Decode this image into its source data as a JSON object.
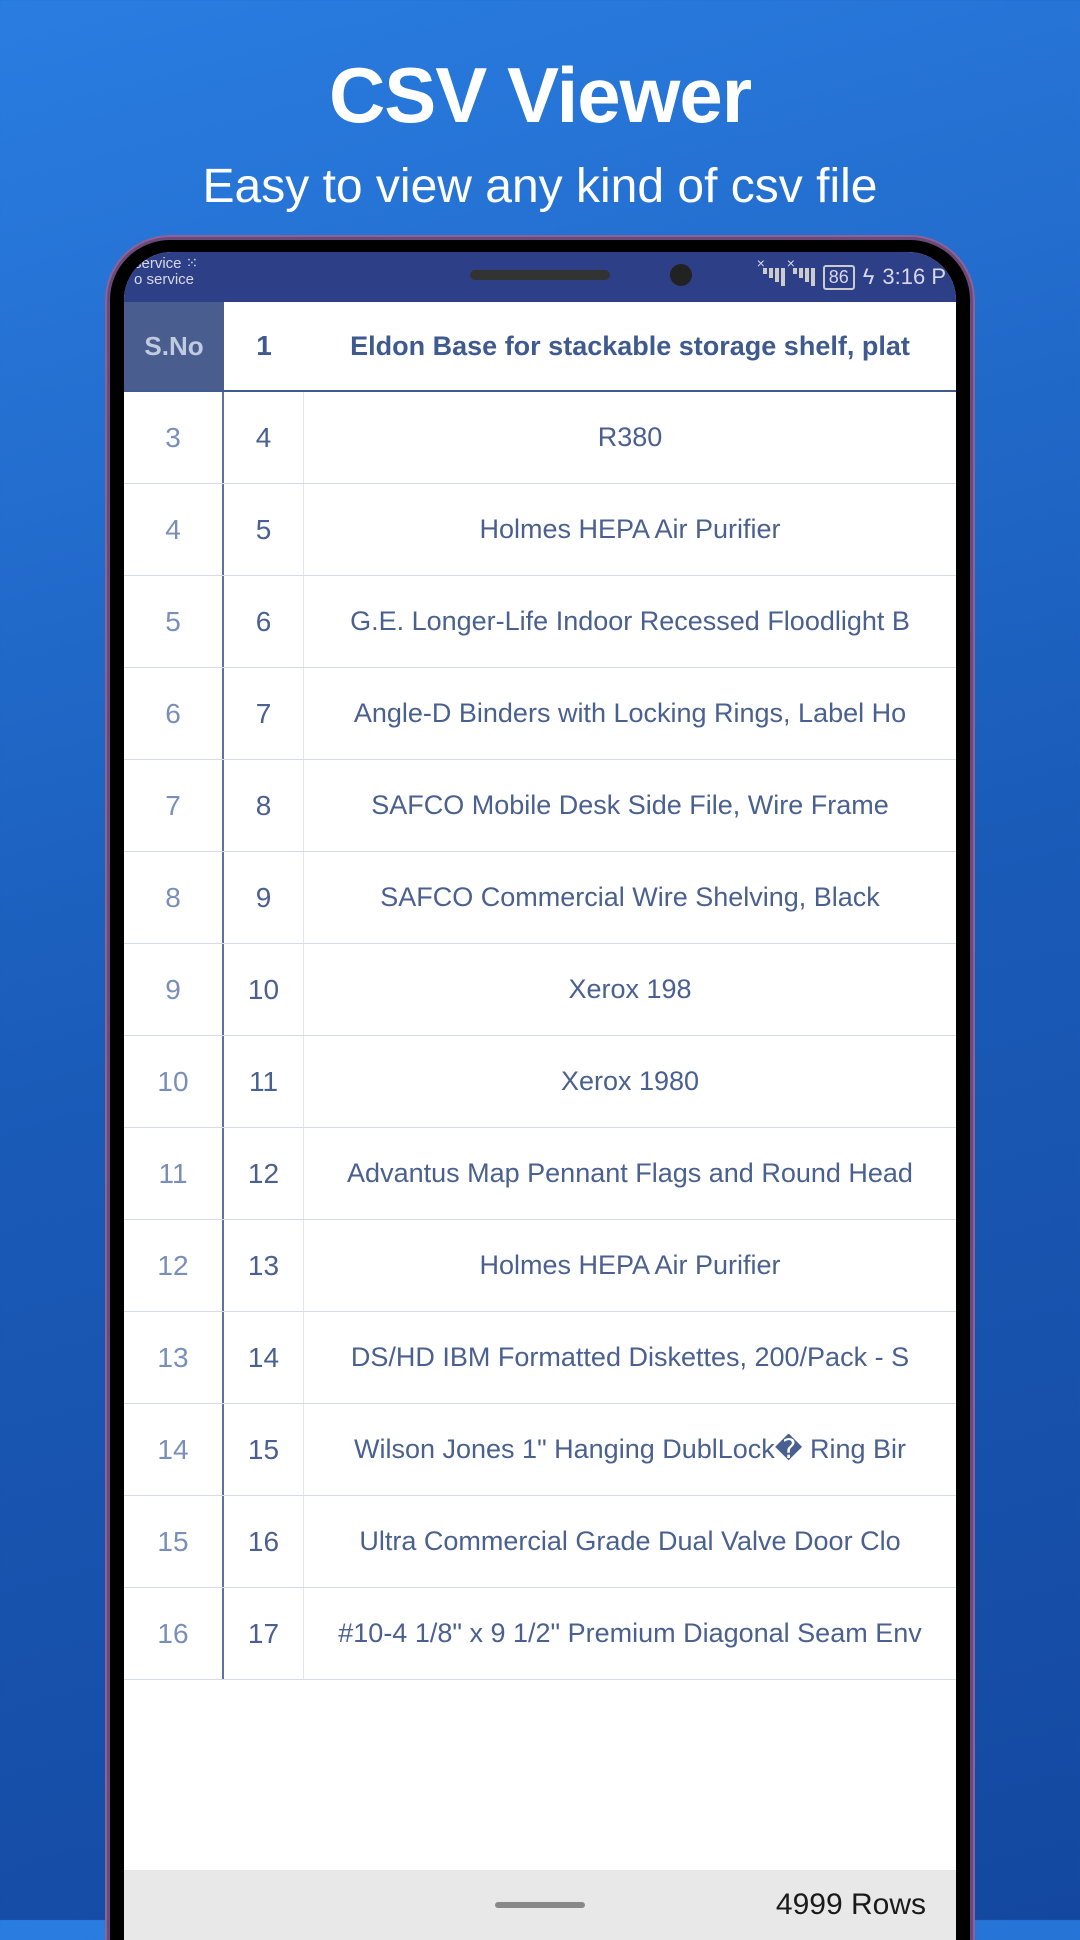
{
  "promo": {
    "title": "CSV Viewer",
    "subtitle": "Easy to view any kind of csv file"
  },
  "statusbar": {
    "service_top": "service",
    "service_bottom": "o service",
    "battery": "86",
    "time": "3:16 P"
  },
  "table": {
    "header": {
      "sno": "S.No",
      "col1": "1",
      "col2": "Eldon Base for stackable storage shelf, plat"
    },
    "rows": [
      {
        "sno": "3",
        "col1": "4",
        "col2": "R380"
      },
      {
        "sno": "4",
        "col1": "5",
        "col2": "Holmes HEPA Air Purifier"
      },
      {
        "sno": "5",
        "col1": "6",
        "col2": "G.E. Longer-Life Indoor Recessed Floodlight B"
      },
      {
        "sno": "6",
        "col1": "7",
        "col2": "Angle-D Binders with Locking Rings, Label Ho"
      },
      {
        "sno": "7",
        "col1": "8",
        "col2": "SAFCO Mobile Desk Side File, Wire Frame"
      },
      {
        "sno": "8",
        "col1": "9",
        "col2": "SAFCO Commercial Wire Shelving, Black"
      },
      {
        "sno": "9",
        "col1": "10",
        "col2": "Xerox 198"
      },
      {
        "sno": "10",
        "col1": "11",
        "col2": "Xerox 1980"
      },
      {
        "sno": "11",
        "col1": "12",
        "col2": "Advantus Map Pennant Flags and Round Head"
      },
      {
        "sno": "12",
        "col1": "13",
        "col2": "Holmes HEPA Air Purifier"
      },
      {
        "sno": "13",
        "col1": "14",
        "col2": "DS/HD IBM Formatted Diskettes, 200/Pack - S"
      },
      {
        "sno": "14",
        "col1": "15",
        "col2": "Wilson Jones 1\" Hanging DublLock� Ring Bir"
      },
      {
        "sno": "15",
        "col1": "16",
        "col2": "Ultra Commercial Grade Dual Valve Door Clo"
      },
      {
        "sno": "16",
        "col1": "17",
        "col2": "#10-4 1/8\" x 9 1/2\" Premium Diagonal Seam Env"
      }
    ]
  },
  "footer": {
    "rows_label": "4999 Rows"
  }
}
